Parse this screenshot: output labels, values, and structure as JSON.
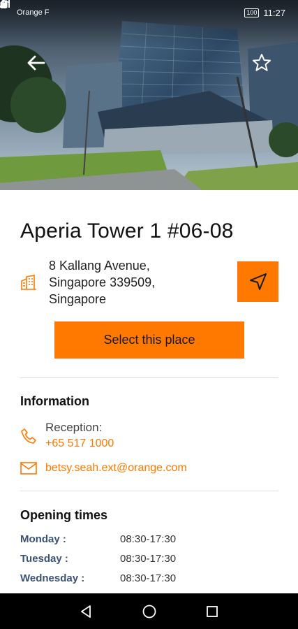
{
  "status_bar": {
    "carrier": "Orange F",
    "battery": "100",
    "time": "11:27"
  },
  "header": {
    "back_icon": "arrow-left-icon",
    "favorite_icon": "star-outline-icon"
  },
  "place": {
    "title": "Aperia Tower 1 #06-08",
    "address_lines": [
      "8 Kallang Avenue,",
      "Singapore 339509,",
      "Singapore"
    ],
    "building_icon": "building-icon",
    "navigate_icon": "navigation-arrow-icon"
  },
  "actions": {
    "select_label": "Select this place"
  },
  "information": {
    "heading": "Information",
    "reception_label": "Reception:",
    "reception_phone": "+65 517 1000",
    "email": "betsy.seah.ext@orange.com"
  },
  "opening_times": {
    "heading": "Opening times",
    "rows": [
      {
        "day": "Monday :",
        "hours": "08:30-17:30"
      },
      {
        "day": "Tuesday :",
        "hours": "08:30-17:30"
      },
      {
        "day": "Wednesday :",
        "hours": "08:30-17:30"
      }
    ]
  },
  "colors": {
    "accent": "#ff7900",
    "day_label": "#3b5277",
    "nav_bar": "#000000"
  }
}
